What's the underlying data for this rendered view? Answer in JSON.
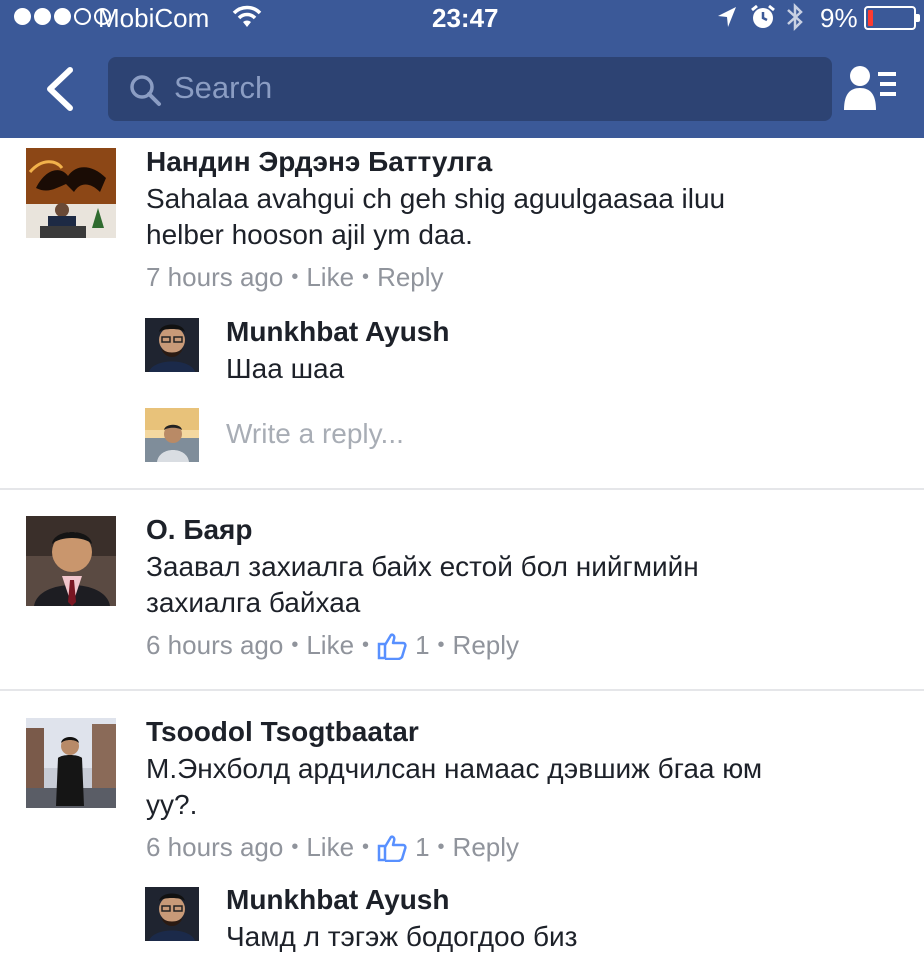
{
  "status_bar": {
    "carrier": "MobiCom",
    "time": "23:47",
    "battery_percent": "9%",
    "battery_level": 0.09,
    "signal_bars": 3,
    "signal_total": 5,
    "icons": [
      "wifi-icon",
      "location-arrow-icon",
      "alarm-icon",
      "bluetooth-icon",
      "battery-icon"
    ]
  },
  "nav": {
    "search_placeholder": "Search",
    "icons": [
      "back-chevron-icon",
      "search-icon",
      "friends-list-icon"
    ],
    "accent_color": "#3b5998"
  },
  "comments": [
    {
      "author": "Нандин Эрдэнэ Баттулга",
      "text_lines": [
        "Sahalaa avahgui ch geh shig aguulgaasaa iluu",
        "helber hooson ajil ym daa."
      ],
      "time": "7 hours ago",
      "like_label": "Like",
      "reply_label": "Reply",
      "like_count": null,
      "replies": [
        {
          "author": "Munkhbat Ayush",
          "text": "Шаа шаа"
        }
      ],
      "reply_placeholder": "Write a reply..."
    },
    {
      "author": "О. Баяр",
      "text_lines": [
        "Заавал захиалга байх естой бол нийгмийн",
        "захиалга байхаа"
      ],
      "time": "6 hours ago",
      "like_label": "Like",
      "reply_label": "Reply",
      "like_count": "1",
      "replies": []
    },
    {
      "author": "Tsoodol Tsogtbaatar",
      "text_lines": [
        "М.Энхболд ардчилсан намаас дэвшиж бгаа юм",
        "уу?."
      ],
      "time": "6 hours ago",
      "like_label": "Like",
      "reply_label": "Reply",
      "like_count": "1",
      "replies": [
        {
          "author": "Munkhbat Ayush",
          "text": "Чамд л тэгэж бодогдоо биз"
        }
      ]
    }
  ]
}
